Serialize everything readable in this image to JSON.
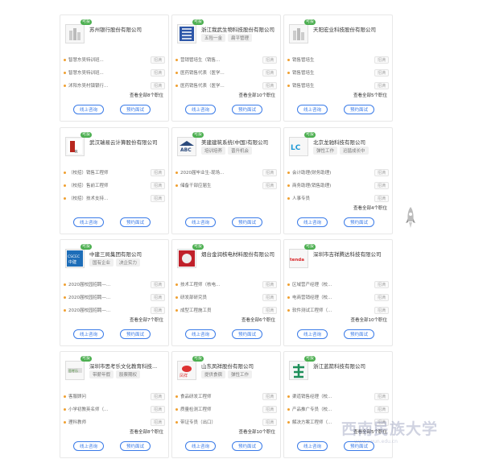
{
  "cards": [
    {
      "name": "苏州银行股份有限公司",
      "tags": [],
      "logo": "building-icon",
      "jobs": [
        {
          "title": "智慧东吴特训班...",
          "tag": "招满"
        },
        {
          "title": "智慧东吴特训班...",
          "tag": "招满"
        },
        {
          "title": "沭阳东吴村镇银行...",
          "tag": "招满"
        }
      ],
      "view_all": "查看全部8个职位"
    },
    {
      "name": "浙江我武生物科技股份有限公司",
      "tags": [
        "五险一金",
        "扁平管理"
      ],
      "logo": "wowu-icon",
      "jobs": [
        {
          "title": "营销管培生（销售...",
          "tag": "招满"
        },
        {
          "title": "医药销售代表（医学...",
          "tag": "招满"
        },
        {
          "title": "医药销售代表（医学...",
          "tag": "招满"
        }
      ],
      "view_all": "查看全部10个职位"
    },
    {
      "name": "天阳宏业科技股份有限公司",
      "tags": [],
      "logo": "building-icon",
      "jobs": [
        {
          "title": "销售管培生",
          "tag": "招满"
        },
        {
          "title": "销售管培生",
          "tag": "招满"
        },
        {
          "title": "销售管培生",
          "tag": "招满"
        }
      ],
      "view_all": "查看全部5个职位"
    },
    {
      "name": "武汉瑞易云计算股份有限公司",
      "tags": [],
      "logo": "ruiyi-icon",
      "jobs": [
        {
          "title": "（校招）销售工程师",
          "tag": "招满"
        },
        {
          "title": "（校招）售前工程师",
          "tag": "招满"
        },
        {
          "title": "（校招）技术支持...",
          "tag": "招满"
        }
      ],
      "view_all": ""
    },
    {
      "name": "美建建筑系统(中国)有限公司",
      "tags": [
        "培训培养",
        "晋升机会"
      ],
      "logo": "abc-icon",
      "jobs": [
        {
          "title": "2020届毕业生-现场...",
          "tag": "招满"
        },
        {
          "title": "储备干部应届生",
          "tag": "招满"
        }
      ],
      "view_all": ""
    },
    {
      "name": "北京龙驰科技有限公司",
      "tags": [
        "弹性工作",
        "迅猛成长中"
      ],
      "logo": "lc-icon",
      "jobs": [
        {
          "title": "会计助理(财务助理)",
          "tag": "招满"
        },
        {
          "title": "商务助理(销售助理)",
          "tag": "招满"
        },
        {
          "title": "人事专员",
          "tag": "招满"
        }
      ],
      "view_all": "查看全部4个职位"
    },
    {
      "name": "中建三局集团有限公司",
      "tags": [
        "国有企业",
        "决企实力"
      ],
      "logo": "cscec-icon",
      "jobs": [
        {
          "title": "2020届校园招聘—...",
          "tag": "招满"
        },
        {
          "title": "2020届校园招聘—...",
          "tag": "招满"
        },
        {
          "title": "2020届校园招聘—...",
          "tag": "招满"
        }
      ],
      "view_all": "查看全部7个职位"
    },
    {
      "name": "烟台金润核电材料股份有限公司",
      "tags": [],
      "logo": "jinrun-icon",
      "jobs": [
        {
          "title": "技术工程师（核电...",
          "tag": "招满"
        },
        {
          "title": "研发部研究员",
          "tag": "招满"
        },
        {
          "title": "成型工程施工员",
          "tag": "招满"
        }
      ],
      "view_all": "查看全部6个职位"
    },
    {
      "name": "深圳市吉祥腾达科技有限公司",
      "tags": [],
      "logo": "tenda-icon",
      "jobs": [
        {
          "title": "区域营产经理（校...",
          "tag": "招满"
        },
        {
          "title": "电商营销经理（校...",
          "tag": "招满"
        },
        {
          "title": "软件测试工程师（...",
          "tag": "招满"
        }
      ],
      "view_all": "查看全部10个职位"
    },
    {
      "name": "深圳市思考乐文化教育科技...",
      "tags": [
        "带薪年假",
        "股票期权"
      ],
      "logo": "sikaole-icon",
      "jobs": [
        {
          "title": "客服顾问",
          "tag": "招满"
        },
        {
          "title": "小学初教英名师（...",
          "tag": "招满"
        },
        {
          "title": "理科教师",
          "tag": "招满"
        }
      ],
      "view_all": "查看全部8个职位"
    },
    {
      "name": "山东凤祥股份有限公司",
      "tags": [
        "提供食宿",
        "弹性工作"
      ],
      "logo": "fengxiang-icon",
      "jobs": [
        {
          "title": "食品研发工程师",
          "tag": "招满"
        },
        {
          "title": "质量检测工程师",
          "tag": "招满"
        },
        {
          "title": "带证专员（出口）",
          "tag": "招满"
        }
      ],
      "view_all": "查看全部10个职位"
    },
    {
      "name": "浙江蓝箭科技有限公司",
      "tags": [],
      "logo": "lanjian-icon",
      "jobs": [
        {
          "title": "渠道销售经理（校...",
          "tag": "招满"
        },
        {
          "title": "产品推广专员（校...",
          "tag": "招满"
        },
        {
          "title": "解决方案工程师（...",
          "tag": "招满"
        }
      ],
      "view_all": "查看全部5个职位"
    }
  ],
  "labels": {
    "consult": "线上咨询",
    "interview": "预约面试",
    "badge": "可投"
  },
  "watermark": {
    "main": "西南民族大学",
    "sub": "www.swun.edu.cn"
  },
  "colors": {
    "accent": "#3a7be8",
    "badge": "#4caf50",
    "dot": "#f0a030"
  }
}
